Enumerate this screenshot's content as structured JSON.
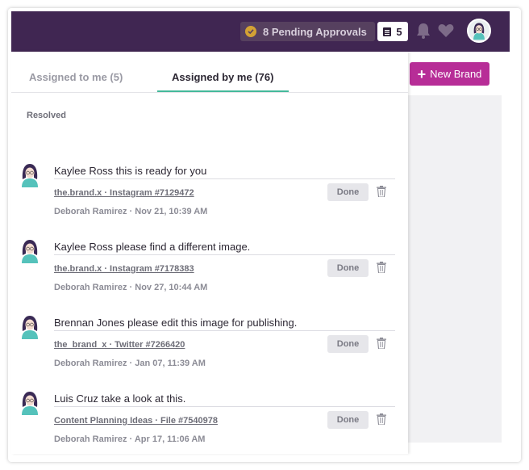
{
  "topbar": {
    "pending_label": "8 Pending Approvals",
    "counter_value": "5"
  },
  "new_brand_label": "New Brand",
  "tabs": [
    {
      "label": "Assigned to me (5)",
      "active": false
    },
    {
      "label": "Assigned by me (76)",
      "active": true
    }
  ],
  "section_label": "Resolved",
  "comments": [
    {
      "text": "Kaylee Ross this is ready for you",
      "link": "the.brand.x · Instagram #7129472",
      "meta": "Deborah Ramirez · Nov 21, 10:39 AM",
      "done_label": "Done"
    },
    {
      "text": "Kaylee Ross please find a different image.",
      "link": "the.brand.x · Instagram #7178383",
      "meta": "Deborah Ramirez · Nov 27, 10:44 AM",
      "done_label": "Done"
    },
    {
      "text": "Brennan Jones please edit this image for publishing.",
      "link": "the_brand_x · Twitter #7266420",
      "meta": "Deborah Ramirez · Jan 07, 11:39 AM",
      "done_label": "Done"
    },
    {
      "text": "Luis Cruz take a look at this.",
      "link": "Content Planning Ideas · File #7540978",
      "meta": "Deborah Ramirez · Apr 17, 11:06 AM",
      "done_label": "Done"
    }
  ],
  "colors": {
    "topbar": "#402652",
    "accent_tab": "#44b99a",
    "new_brand": "#b72d97"
  }
}
